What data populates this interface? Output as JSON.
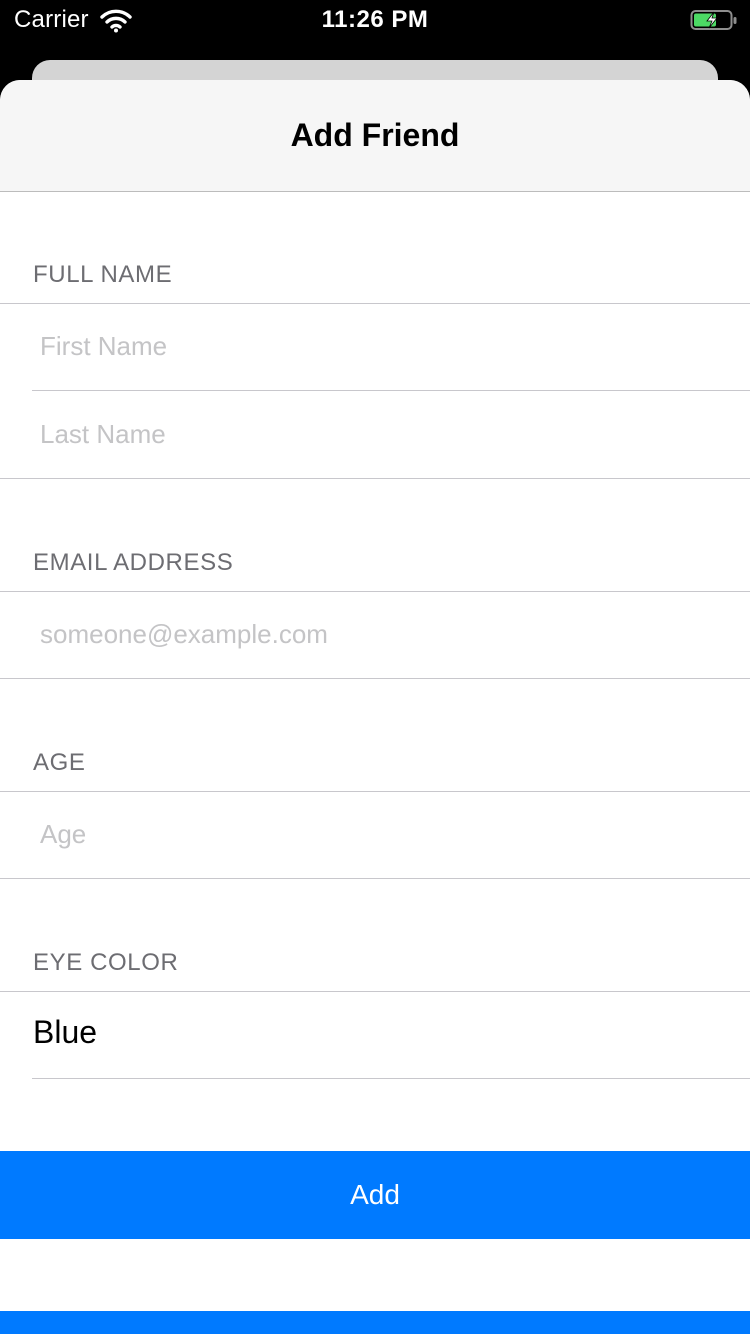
{
  "status_bar": {
    "carrier": "Carrier",
    "time": "11:26 PM",
    "wifi_icon": "wifi-icon",
    "battery_icon": "battery-charging-icon"
  },
  "nav": {
    "title": "Add Friend"
  },
  "form": {
    "full_name": {
      "header": "FULL NAME",
      "first_name_placeholder": "First Name",
      "last_name_placeholder": "Last Name"
    },
    "email": {
      "header": "EMAIL ADDRESS",
      "placeholder": "someone@example.com"
    },
    "age": {
      "header": "AGE",
      "placeholder": "Age"
    },
    "eye_color": {
      "header": "EYE COLOR",
      "selected_value": "Blue"
    }
  },
  "actions": {
    "add_label": "Add"
  },
  "colors": {
    "accent": "#007aff",
    "nav_background": "#f6f6f6",
    "section_header": "#6d6d72",
    "placeholder": "#c4c4c6",
    "separator": "#c8c7cc"
  }
}
